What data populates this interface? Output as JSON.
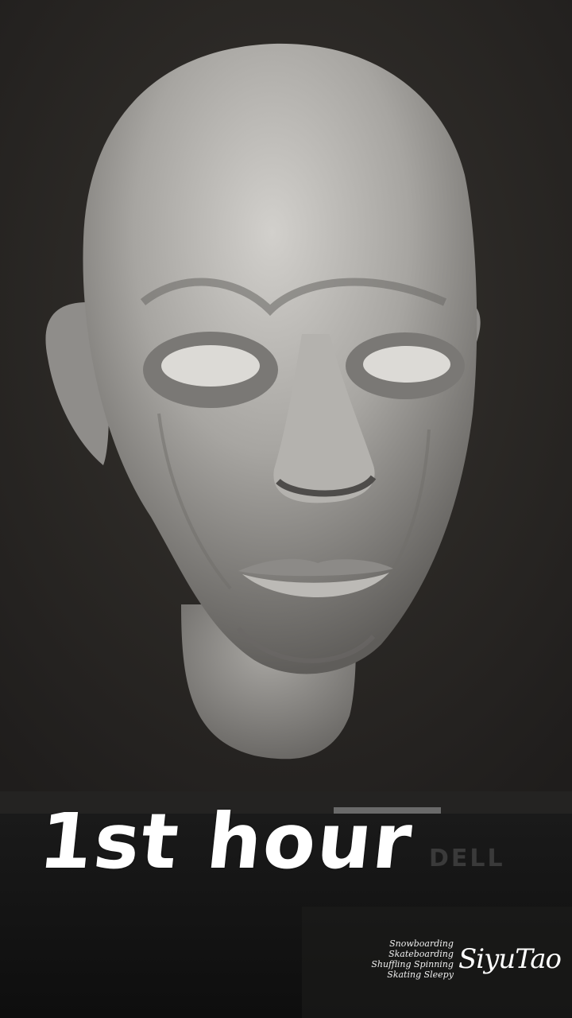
{
  "caption": "1st hour",
  "monitor_brand": "DELL",
  "watermark": {
    "activities": [
      "Snowboarding",
      "Skateboarding",
      "Shuffling Spinning",
      "Skating Sleepy"
    ],
    "signature": "SiyuTao"
  },
  "colors": {
    "background": "#161616",
    "viewport": "#2b2928",
    "clay": "#a8a6a3",
    "caption": "#ffffff"
  }
}
